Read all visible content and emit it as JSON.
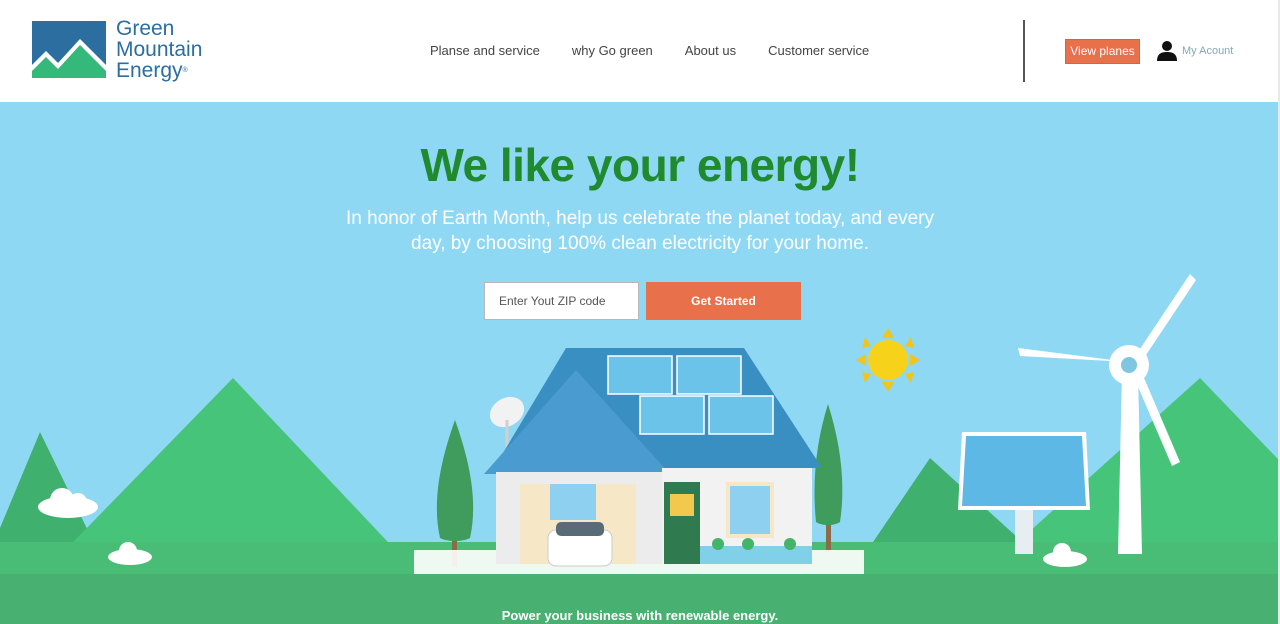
{
  "brand": {
    "logo_line1": "Green",
    "logo_line2": "Mountain",
    "logo_line3": "Energy",
    "logo_mark": "®",
    "colors": {
      "blue": "#2d6ea0",
      "green": "#34b97a",
      "orange": "#e8704a"
    }
  },
  "nav": {
    "items": [
      {
        "label": "Planse and service"
      },
      {
        "label": "why Go green"
      },
      {
        "label": "About us"
      },
      {
        "label": "Customer service"
      }
    ]
  },
  "header": {
    "view_plans_label": "View planes",
    "account_label": "My Acount",
    "account_icon": "user-icon"
  },
  "hero": {
    "headline": "We like your energy!",
    "subline": "In honor of Earth Month, help us celebrate the planet today, and every day, by choosing 100% clean electricity for your home.",
    "zip_placeholder": "Enter Yout ZIP code",
    "cta_label": "Get Started",
    "colors": {
      "sky": "#8fd8f4",
      "headline": "#1f8a2e",
      "hill": "#46c47a"
    }
  },
  "band": {
    "text": "Power your business with renewable energy."
  }
}
